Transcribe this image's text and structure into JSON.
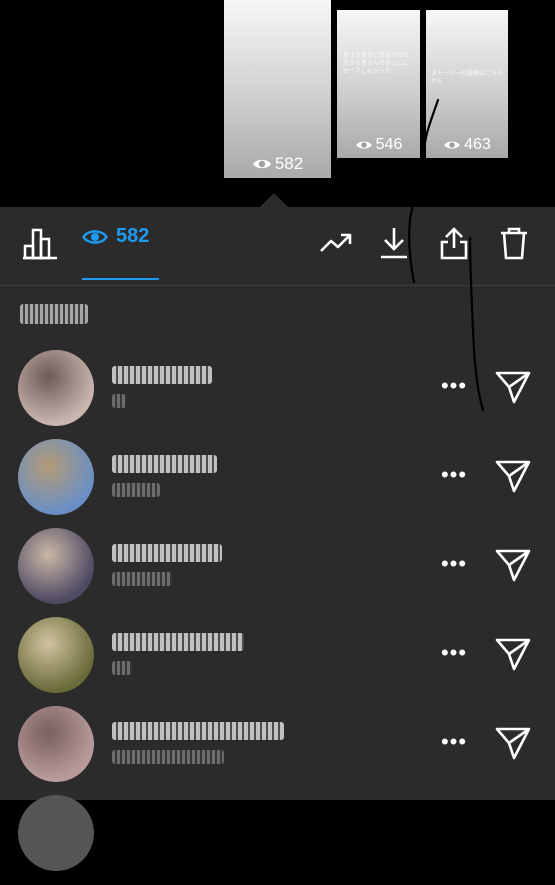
{
  "stories": [
    {
      "views": "582",
      "caption": ""
    },
    {
      "views": "546",
      "caption": "皆さま本日に新規された方から皆さんのきっとにセイマしなかった"
    },
    {
      "views": "463",
      "caption": "ストーリーの投稿はこちらから"
    }
  ],
  "toolbar": {
    "views_count": "582"
  },
  "viewers": [
    {
      "avatar_colors": [
        "#c8b5b0",
        "#6e5a55"
      ]
    },
    {
      "avatar_colors": [
        "#6b8fc4",
        "#b39b77"
      ]
    },
    {
      "avatar_colors": [
        "#4f4a63",
        "#c9b7a6"
      ]
    },
    {
      "avatar_colors": [
        "#6a6b3a",
        "#d1c3a0"
      ]
    },
    {
      "avatar_colors": [
        "#b89a9a",
        "#7a6060"
      ]
    }
  ],
  "colors": {
    "accent": "#1e9bf0",
    "sheet": "#2b2b2b"
  }
}
